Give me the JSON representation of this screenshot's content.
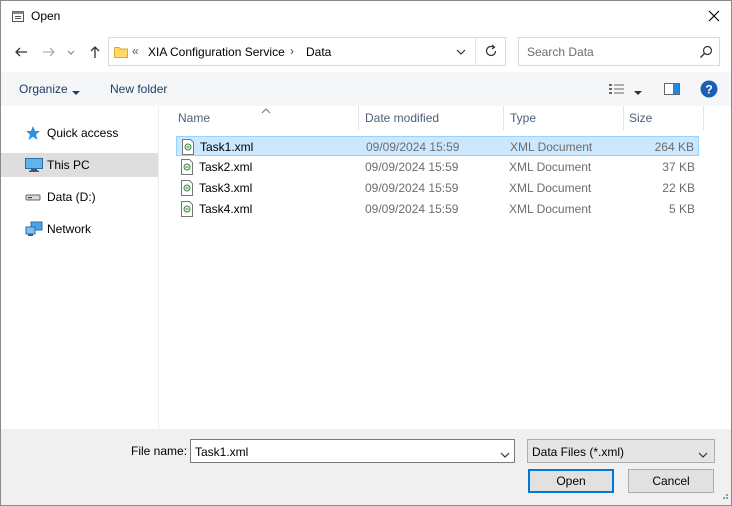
{
  "window": {
    "title": "Open"
  },
  "address": {
    "overflow": "«",
    "path": [
      "XIA Configuration Service",
      "Data"
    ],
    "separator": "›"
  },
  "search": {
    "placeholder": "Search Data"
  },
  "toolbar": {
    "organize": "Organize",
    "new_folder": "New folder"
  },
  "nav": {
    "items": [
      {
        "label": "Quick access",
        "icon": "star-icon",
        "selected": false
      },
      {
        "label": "This PC",
        "icon": "computer-icon",
        "selected": true
      },
      {
        "label": "Data (D:)",
        "icon": "drive-icon",
        "selected": false
      },
      {
        "label": "Network",
        "icon": "network-icon",
        "selected": false
      }
    ]
  },
  "columns": {
    "name": "Name",
    "date": "Date modified",
    "type": "Type",
    "size": "Size"
  },
  "files": [
    {
      "name": "Task1.xml",
      "date": "09/09/2024 15:59",
      "type": "XML Document",
      "size": "264 KB",
      "selected": true
    },
    {
      "name": "Task2.xml",
      "date": "09/09/2024 15:59",
      "type": "XML Document",
      "size": "37 KB",
      "selected": false
    },
    {
      "name": "Task3.xml",
      "date": "09/09/2024 15:59",
      "type": "XML Document",
      "size": "22 KB",
      "selected": false
    },
    {
      "name": "Task4.xml",
      "date": "09/09/2024 15:59",
      "type": "XML Document",
      "size": "5 KB",
      "selected": false
    }
  ],
  "bottom": {
    "file_name_label": "File name:",
    "file_name_value": "Task1.xml",
    "file_type": "Data Files (*.xml)",
    "open": "Open",
    "cancel": "Cancel"
  },
  "colors": {
    "selection": "#cce8ff",
    "accent": "#0078d7",
    "link": "#1e3f66"
  }
}
